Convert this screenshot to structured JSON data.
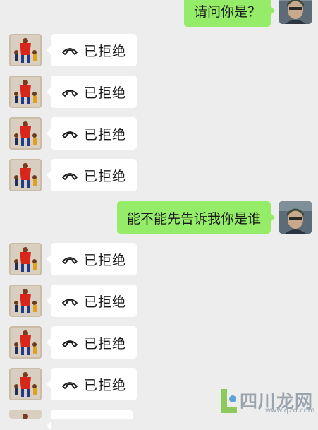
{
  "messages": [
    {
      "side": "out",
      "text": "请问你是？"
    },
    {
      "side": "in",
      "icon": "hangup-phone-icon",
      "text": "已拒绝"
    },
    {
      "side": "in",
      "icon": "hangup-phone-icon",
      "text": "已拒绝"
    },
    {
      "side": "in",
      "icon": "hangup-phone-icon",
      "text": "已拒绝"
    },
    {
      "side": "in",
      "icon": "hangup-phone-icon",
      "text": "已拒绝"
    },
    {
      "side": "out",
      "text": "能不能先告诉我你是谁"
    },
    {
      "side": "in",
      "icon": "hangup-phone-icon",
      "text": "已拒绝"
    },
    {
      "side": "in",
      "icon": "hangup-phone-icon",
      "text": "已拒绝"
    },
    {
      "side": "in",
      "icon": "hangup-phone-icon",
      "text": "已拒绝"
    },
    {
      "side": "in",
      "icon": "hangup-phone-icon",
      "text": "已拒绝"
    }
  ],
  "watermark": {
    "text": "四川龙网",
    "url": "www.q2d.com"
  },
  "colors": {
    "background": "#ededed",
    "outgoing_bubble": "#95ec69",
    "incoming_bubble": "#ffffff"
  }
}
